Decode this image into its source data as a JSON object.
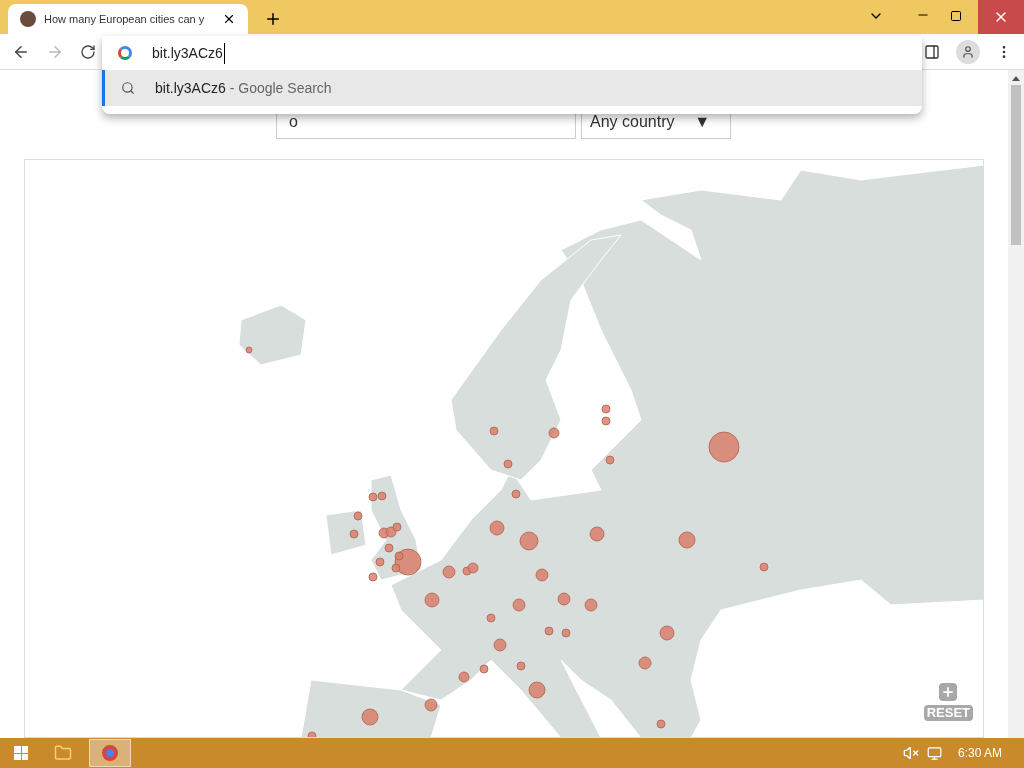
{
  "browser": {
    "tab": {
      "title": "How many European cities can y"
    },
    "nav": {
      "forward_disabled": true
    },
    "omnibox": {
      "value": "bit.ly3ACz6"
    },
    "suggestions": [
      {
        "text": "bit.ly3ACz6",
        "source": "- Google Search",
        "selected": true
      }
    ]
  },
  "page": {
    "search": {
      "value": "o"
    },
    "country": {
      "value": "Any country",
      "arrow": "▼"
    },
    "map": {
      "reset": "RESET"
    }
  },
  "taskbar": {
    "clock": "6:30 AM"
  }
}
